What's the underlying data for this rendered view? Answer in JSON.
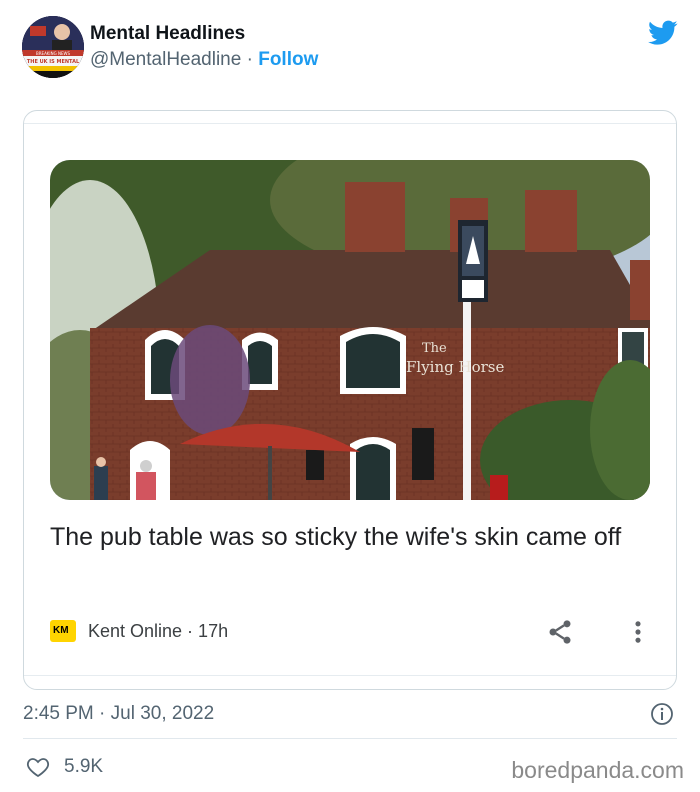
{
  "tweet": {
    "author_name": "Mental Headlines",
    "handle": "@MentalHeadline",
    "separator": " · ",
    "follow_label": "Follow",
    "avatar": {
      "banner_top": "BREAKING NEWS",
      "banner_text": "THE UK IS MENTAL"
    },
    "icons": {
      "brand": "twitter-bird-icon",
      "share": "share-icon",
      "more": "more-vertical-icon",
      "info": "info-icon",
      "like": "heart-icon"
    },
    "timestamp": "2:45 PM · Jul 30, 2022",
    "likes": "5.9K",
    "colors": {
      "accent": "#1d9bf0",
      "secondary_text": "#536471",
      "border": "#cfd9de"
    }
  },
  "card": {
    "photo": {
      "sign_line1": "The",
      "sign_line2": "Flying Horse"
    },
    "headline": "The pub table was so sticky the wife's skin came off",
    "source_logo": "KM",
    "source": "Kent Online · 17h"
  },
  "watermark": "boredpanda.com"
}
